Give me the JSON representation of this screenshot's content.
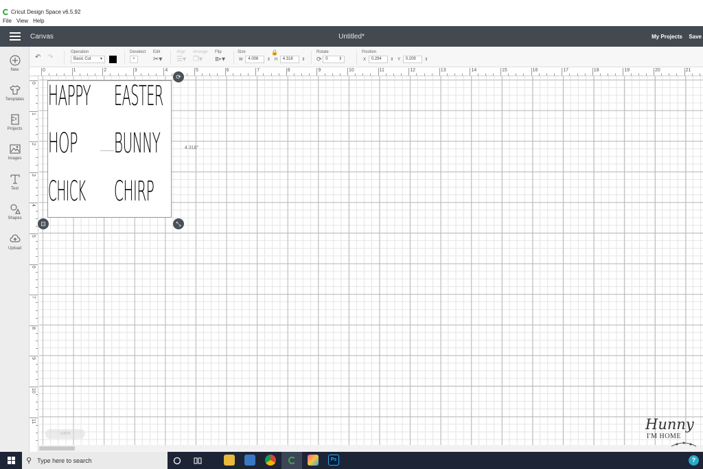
{
  "window": {
    "title": "Cricut Design Space  v6.5.92"
  },
  "menu": [
    "File",
    "View",
    "Help"
  ],
  "header": {
    "section": "Canvas",
    "doc_title": "Untitled*",
    "my_projects": "My Projects",
    "save": "Save"
  },
  "sidebar": [
    {
      "label": "New",
      "icon": "plus-circle-icon"
    },
    {
      "label": "Templates",
      "icon": "tshirt-icon"
    },
    {
      "label": "Projects",
      "icon": "projects-icon"
    },
    {
      "label": "Images",
      "icon": "image-icon"
    },
    {
      "label": "Text",
      "icon": "text-icon"
    },
    {
      "label": "Shapes",
      "icon": "shapes-icon"
    },
    {
      "label": "Upload",
      "icon": "upload-cloud-icon"
    }
  ],
  "toolbar": {
    "operation_label": "Operation",
    "operation_value": "Basic Cut",
    "color": "#000000",
    "deselect_label": "Deselect",
    "edit_label": "Edit",
    "align_label": "Align",
    "arrange_label": "Arrange",
    "flip_label": "Flip",
    "size_label": "Size",
    "w_label": "W",
    "w_value": "4.006",
    "h_label": "H",
    "h_value": "4.318",
    "rotate_label": "Rotate",
    "rotate_value": "0",
    "position_label": "Position",
    "x_label": "X",
    "x_value": "0.294",
    "y_label": "Y",
    "y_value": "0.209"
  },
  "ruler": {
    "top": [
      "0",
      "1",
      "2",
      "3",
      "4",
      "5",
      "6",
      "7",
      "8",
      "9",
      "10",
      "11",
      "12",
      "13",
      "14",
      "15",
      "16",
      "17",
      "18",
      "19",
      "20",
      "21"
    ],
    "left": [
      "0",
      "1",
      "2",
      "3",
      "4",
      "5",
      "6",
      "7",
      "8",
      "9",
      "10",
      "11"
    ]
  },
  "design": {
    "words": [
      "HAPPY",
      "EASTER",
      "HOP",
      "BUNNY",
      "CHICK",
      "CHIRP"
    ],
    "height_label": "4.318\""
  },
  "zoom_hint": "100%",
  "watermark": {
    "script": "Hunny",
    "sub": "I'M HOME"
  },
  "taskbar": {
    "search_placeholder": "Type here to search",
    "ps_label": "Ps"
  }
}
